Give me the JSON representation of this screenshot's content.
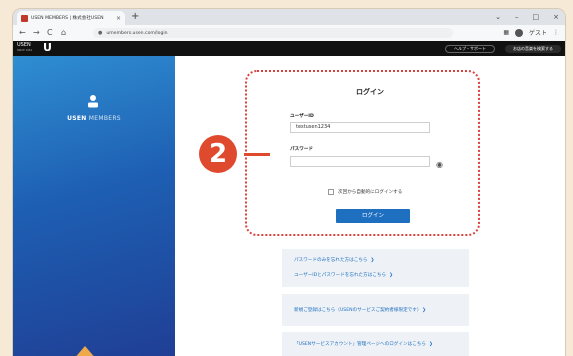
{
  "browser": {
    "tab_title": "USEN MEMBERS | 株式会社USEN",
    "tab_close": "×",
    "new_tab": "+",
    "window_controls": [
      "⌄",
      "–",
      "□",
      "×"
    ],
    "url": "umembers.usen.com/login",
    "nav_back": "←",
    "nav_forward": "→",
    "nav_reload": "C",
    "nav_home": "⌂",
    "profile_label": "ゲスト"
  },
  "site_header": {
    "brand_top": "USEN",
    "brand_sub": "SINCE 1961",
    "brand_u": "U",
    "help_button": "ヘルプ・サポート",
    "login_help_button": "お店の音楽を検索する"
  },
  "left_panel": {
    "brand_bold": "USEN",
    "brand_light": " MEMBERS"
  },
  "login_form": {
    "title": "ログイン",
    "userid_label": "ユーザーID",
    "userid_value": "testusen1234",
    "password_label": "パスワード",
    "password_value": "",
    "remember_label": "次回から自動的にログインする",
    "login_button": "ログイン"
  },
  "callout": {
    "number": "2"
  },
  "links": {
    "forgot_password": "パスワードのみを忘れた方はこちら",
    "forgot_both": "ユーザーIDとパスワードを忘れた方はこちら",
    "register": "新規ご登録はこちら（USENのサービスご契約者様限定です）",
    "service_account": "「USENサービスアカウント」管理ページへのログインはこちら",
    "chevron": "❯"
  },
  "colors": {
    "accent_blue": "#1f6fc0",
    "callout_red": "#df4a2f",
    "panel_gradient_top": "#2f8ed2",
    "panel_gradient_bottom": "#1f3f95"
  }
}
